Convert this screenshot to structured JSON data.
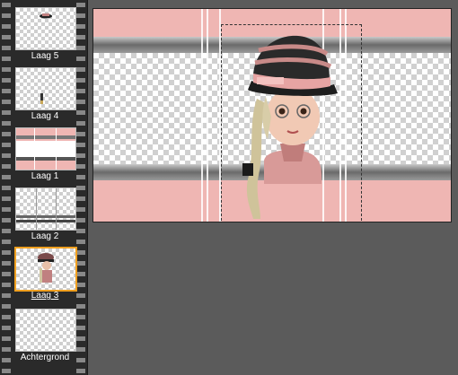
{
  "layers_panel": {
    "layers": [
      {
        "label": "Laag 5",
        "active": false
      },
      {
        "label": "Laag 4",
        "active": false
      },
      {
        "label": "Laag 1",
        "active": false
      },
      {
        "label": "Laag 2",
        "active": false
      },
      {
        "label": "Laag 3",
        "active": true
      },
      {
        "label": "Achtergrond",
        "active": false
      }
    ]
  },
  "colors": {
    "canvas_pink": "#efb6b3",
    "workspace_gray": "#5b5b5b",
    "active_layer_border": "#f0a020",
    "film_strip": "#2a2a2a"
  }
}
